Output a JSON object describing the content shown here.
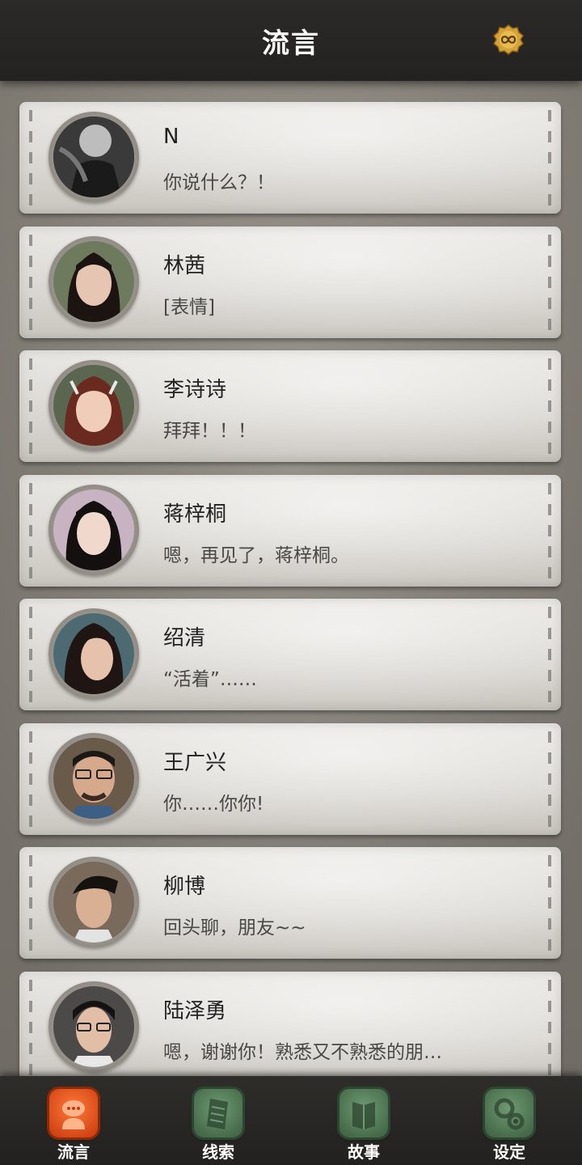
{
  "header": {
    "title": "流言"
  },
  "conversations": [
    {
      "name": "N",
      "message": "你说什么？！"
    },
    {
      "name": "林茜",
      "message": "[表情]"
    },
    {
      "name": "李诗诗",
      "message": "拜拜！！！"
    },
    {
      "name": "蒋梓桐",
      "message": "嗯，再见了，蒋梓桐。"
    },
    {
      "name": "绍清",
      "message": "“活着”……"
    },
    {
      "name": "王广兴",
      "message": "你……你你!"
    },
    {
      "name": "柳博",
      "message": "回头聊，朋友~~"
    },
    {
      "name": "陆泽勇",
      "message": "嗯，谢谢你！熟悉又不熟悉的朋…"
    }
  ],
  "tabs": [
    {
      "label": "流言",
      "icon": "chat-icon",
      "active": true
    },
    {
      "label": "线索",
      "icon": "notes-icon",
      "active": false
    },
    {
      "label": "故事",
      "icon": "book-icon",
      "active": false
    },
    {
      "label": "设定",
      "icon": "gear-icon",
      "active": false
    }
  ],
  "colors": {
    "active_tab": "#e8541a",
    "inactive_tab": "#4f7a55",
    "header_bg": "#2a2826"
  }
}
